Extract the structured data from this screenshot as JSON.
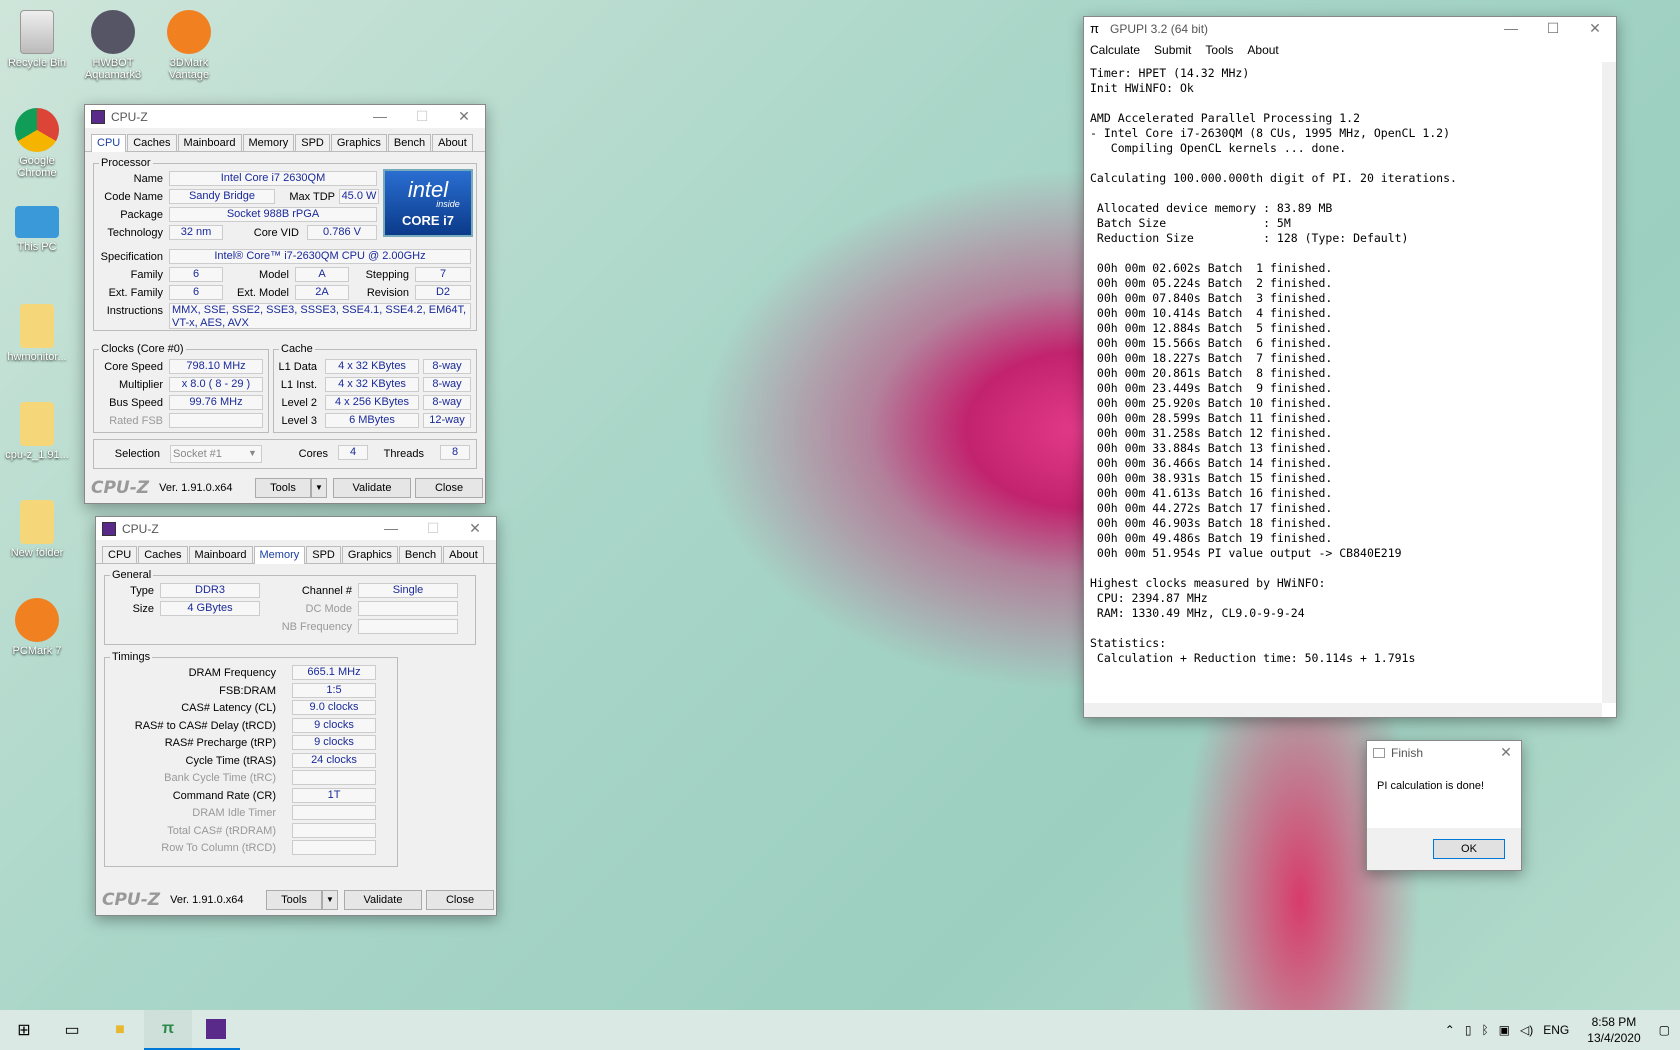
{
  "desktop": {
    "icons": [
      {
        "label": "Recycle Bin"
      },
      {
        "label": "HWBOT Aquamark3"
      },
      {
        "label": "3DMark Vantage"
      },
      {
        "label": "Google Chrome"
      },
      {
        "label": "This PC"
      },
      {
        "label": "hwmonitor..."
      },
      {
        "label": "cpu-z_1.91..."
      },
      {
        "label": "New folder"
      },
      {
        "label": "PCMark 7"
      }
    ]
  },
  "cpuz1": {
    "title": "CPU-Z",
    "tabs": [
      "CPU",
      "Caches",
      "Mainboard",
      "Memory",
      "SPD",
      "Graphics",
      "Bench",
      "About"
    ],
    "processor_legend": "Processor",
    "name_label": "Name",
    "name": "Intel Core i7 2630QM",
    "codename_label": "Code Name",
    "codename": "Sandy Bridge",
    "maxtdp_label": "Max TDP",
    "maxtdp": "45.0 W",
    "package_label": "Package",
    "package": "Socket 988B rPGA",
    "technology_label": "Technology",
    "technology": "32 nm",
    "corevid_label": "Core VID",
    "corevid": "0.786 V",
    "spec_label": "Specification",
    "spec": "Intel® Core™ i7-2630QM CPU @ 2.00GHz",
    "family_label": "Family",
    "family": "6",
    "model_label": "Model",
    "model": "A",
    "stepping_label": "Stepping",
    "stepping": "7",
    "extfamily_label": "Ext. Family",
    "extfamily": "6",
    "extmodel_label": "Ext. Model",
    "extmodel": "2A",
    "revision_label": "Revision",
    "revision": "D2",
    "instr_label": "Instructions",
    "instr": "MMX, SSE, SSE2, SSE3, SSSE3, SSE4.1, SSE4.2, EM64T, VT-x, AES, AVX",
    "clocks_legend": "Clocks (Core #0)",
    "corespeed_label": "Core Speed",
    "corespeed": "798.10 MHz",
    "multiplier_label": "Multiplier",
    "multiplier": "x 8.0 ( 8 - 29 )",
    "busspeed_label": "Bus Speed",
    "busspeed": "99.76 MHz",
    "ratedfsb_label": "Rated FSB",
    "ratedfsb": "",
    "cache_legend": "Cache",
    "l1d_label": "L1 Data",
    "l1d": "4 x 32 KBytes",
    "l1d_way": "8-way",
    "l1i_label": "L1 Inst.",
    "l1i": "4 x 32 KBytes",
    "l1i_way": "8-way",
    "l2_label": "Level 2",
    "l2": "4 x 256 KBytes",
    "l2_way": "8-way",
    "l3_label": "Level 3",
    "l3": "6 MBytes",
    "l3_way": "12-way",
    "selection_label": "Selection",
    "selection": "Socket #1",
    "cores_label": "Cores",
    "cores": "4",
    "threads_label": "Threads",
    "threads": "8",
    "logo": "CPU-Z",
    "version": "Ver. 1.91.0.x64",
    "tools": "Tools",
    "validate": "Validate",
    "close": "Close",
    "intel_badge": {
      "top": "intel",
      "inside": "inside",
      "bottom": "CORE i7"
    }
  },
  "cpuz2": {
    "title": "CPU-Z",
    "tabs": [
      "CPU",
      "Caches",
      "Mainboard",
      "Memory",
      "SPD",
      "Graphics",
      "Bench",
      "About"
    ],
    "general_legend": "General",
    "type_label": "Type",
    "type": "DDR3",
    "channel_label": "Channel #",
    "channel": "Single",
    "size_label": "Size",
    "size": "4 GBytes",
    "dcmode_label": "DC Mode",
    "dcmode": "",
    "nbfreq_label": "NB Frequency",
    "nbfreq": "",
    "timings_legend": "Timings",
    "timings": [
      {
        "label": "DRAM Frequency",
        "value": "665.1 MHz",
        "gray": false
      },
      {
        "label": "FSB:DRAM",
        "value": "1:5",
        "gray": false
      },
      {
        "label": "CAS# Latency (CL)",
        "value": "9.0 clocks",
        "gray": false
      },
      {
        "label": "RAS# to CAS# Delay (tRCD)",
        "value": "9 clocks",
        "gray": false
      },
      {
        "label": "RAS# Precharge (tRP)",
        "value": "9 clocks",
        "gray": false
      },
      {
        "label": "Cycle Time (tRAS)",
        "value": "24 clocks",
        "gray": false
      },
      {
        "label": "Bank Cycle Time (tRC)",
        "value": "",
        "gray": true
      },
      {
        "label": "Command Rate (CR)",
        "value": "1T",
        "gray": false
      },
      {
        "label": "DRAM Idle Timer",
        "value": "",
        "gray": true
      },
      {
        "label": "Total CAS# (tRDRAM)",
        "value": "",
        "gray": true
      },
      {
        "label": "Row To Column (tRCD)",
        "value": "",
        "gray": true
      }
    ],
    "logo": "CPU-Z",
    "version": "Ver. 1.91.0.x64",
    "tools": "Tools",
    "validate": "Validate",
    "close": "Close"
  },
  "gpupi": {
    "title": "GPUPI 3.2 (64 bit)",
    "menu": [
      "Calculate",
      "Submit",
      "Tools",
      "About"
    ],
    "log": "Timer: HPET (14.32 MHz)\nInit HWiNFO: Ok\n\nAMD Accelerated Parallel Processing 1.2\n- Intel Core i7-2630QM (8 CUs, 1995 MHz, OpenCL 1.2)\n   Compiling OpenCL kernels ... done.\n\nCalculating 100.000.000th digit of PI. 20 iterations.\n\n Allocated device memory : 83.89 MB\n Batch Size              : 5M\n Reduction Size          : 128 (Type: Default)\n\n 00h 00m 02.602s Batch  1 finished.\n 00h 00m 05.224s Batch  2 finished.\n 00h 00m 07.840s Batch  3 finished.\n 00h 00m 10.414s Batch  4 finished.\n 00h 00m 12.884s Batch  5 finished.\n 00h 00m 15.566s Batch  6 finished.\n 00h 00m 18.227s Batch  7 finished.\n 00h 00m 20.861s Batch  8 finished.\n 00h 00m 23.449s Batch  9 finished.\n 00h 00m 25.920s Batch 10 finished.\n 00h 00m 28.599s Batch 11 finished.\n 00h 00m 31.258s Batch 12 finished.\n 00h 00m 33.884s Batch 13 finished.\n 00h 00m 36.466s Batch 14 finished.\n 00h 00m 38.931s Batch 15 finished.\n 00h 00m 41.613s Batch 16 finished.\n 00h 00m 44.272s Batch 17 finished.\n 00h 00m 46.903s Batch 18 finished.\n 00h 00m 49.486s Batch 19 finished.\n 00h 00m 51.954s PI value output -> CB840E219\n\nHighest clocks measured by HWiNFO:\n CPU: 2394.87 MHz\n RAM: 1330.49 MHz, CL9.0-9-9-24\n\nStatistics:\n Calculation + Reduction time: 50.114s + 1.791s"
  },
  "finish": {
    "title": "Finish",
    "message": "PI calculation is done!",
    "ok": "OK"
  },
  "taskbar": {
    "lang": "ENG",
    "time": "8:58 PM",
    "date": "13/4/2020"
  }
}
